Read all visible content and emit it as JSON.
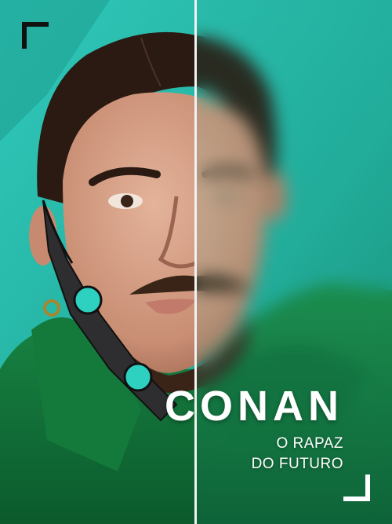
{
  "poster": {
    "title": "CONAN",
    "subtitle_line1": "O RAPAZ",
    "subtitle_line2": "DO FUTURO"
  },
  "colors": {
    "background_teal": "#1fb3a4",
    "costume_green": "#0e6a3a",
    "text": "#ffffff",
    "corner_top_left": "#111111",
    "corner_bottom_right": "#ffffff",
    "divider": "#f2f2f2"
  }
}
